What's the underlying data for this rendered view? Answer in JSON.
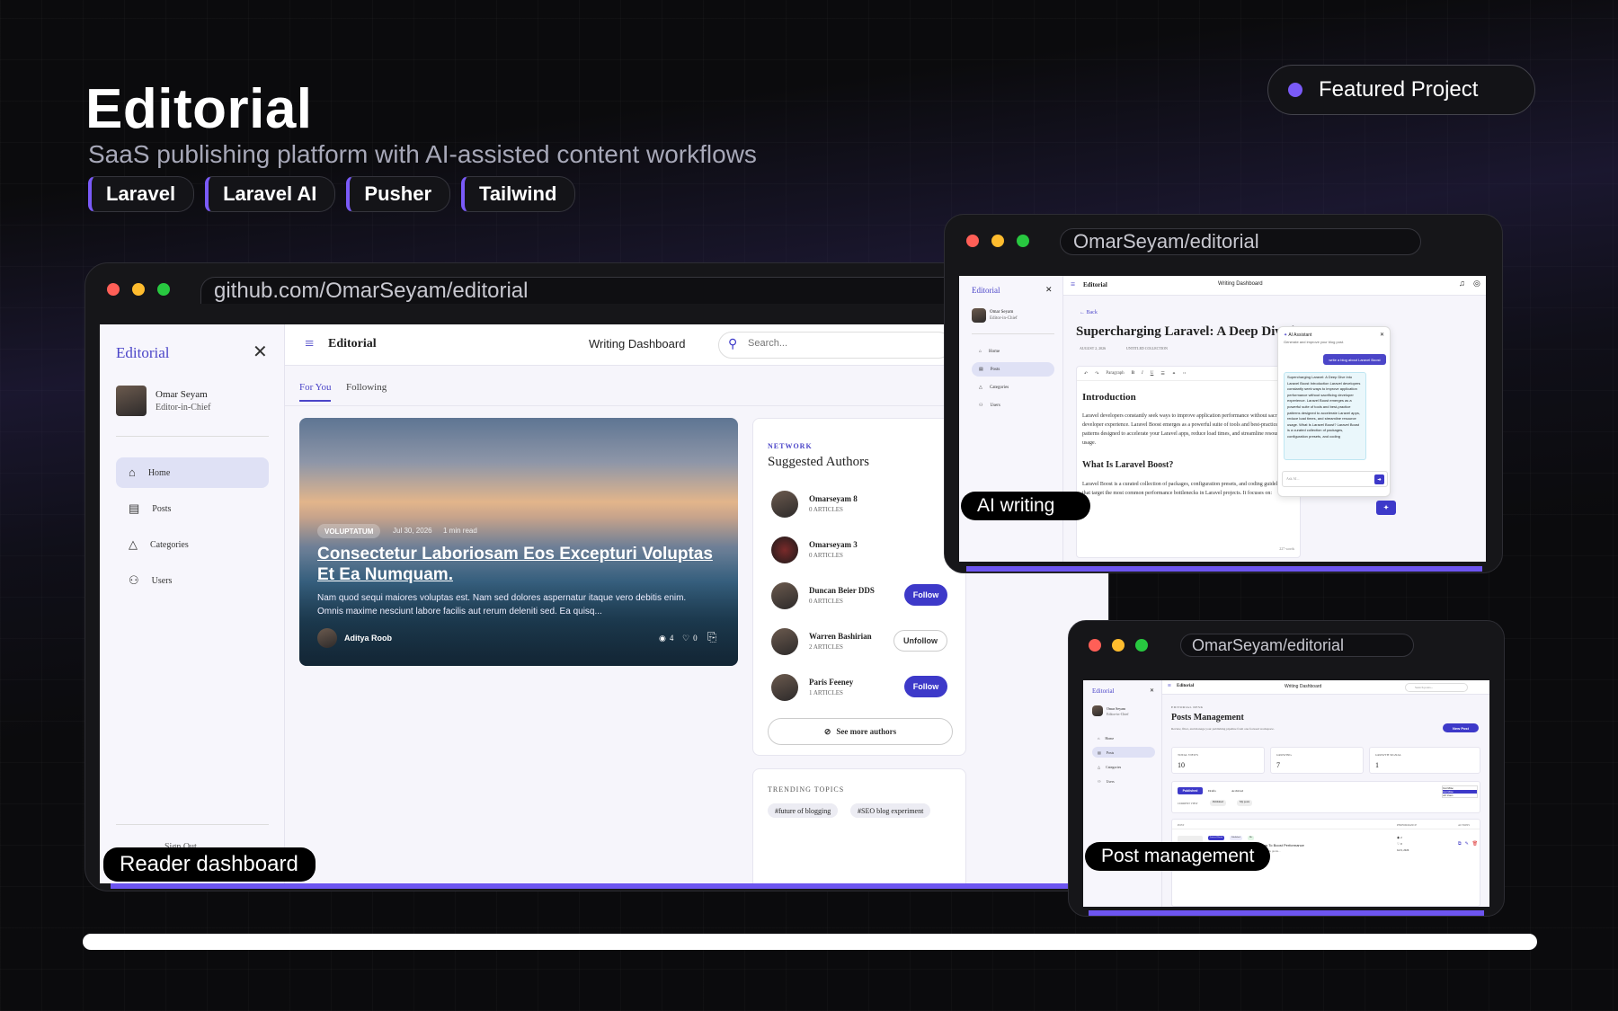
{
  "header": {
    "title": "Editorial",
    "subtitle": "SaaS publishing platform with AI-assisted content workflows",
    "tags": [
      "Laravel",
      "Laravel AI",
      "Pusher",
      "Tailwind"
    ],
    "featured": "Featured Project"
  },
  "colors": {
    "accent": "#7a5af8",
    "brand": "#4b45c8",
    "button": "#3d39c9"
  },
  "main": {
    "url": "github.com/OmarSeyam/editorial",
    "caption": "Reader dashboard",
    "sidebar": {
      "brand": "Editorial",
      "user_name": "Omar Seyam",
      "user_role": "Editor-in-Chief",
      "items": [
        "Home",
        "Posts",
        "Categories",
        "Users"
      ],
      "footer": "Sign Out"
    },
    "topbar": {
      "brand": "Editorial",
      "page": "Writing Dashboard",
      "search_placeholder": "Search..."
    },
    "tabs": [
      "For You",
      "Following"
    ],
    "hero": {
      "badge": "VOLUPTATUM",
      "date": "Jul 30, 2026",
      "read": "1 min read",
      "title": "Consectetur Laboriosam Eos Excepturi Voluptas Et Ea Numquam.",
      "excerpt": "Nam quod sequi maiores voluptas est. Nam sed dolores aspernatur itaque vero debitis enim. Omnis maxime nesciunt labore facilis aut rerum deleniti sed. Ea quisq...",
      "author": "Aditya Roob",
      "views": "4",
      "likes": "0"
    },
    "authors": {
      "eyebrow": "NETWORK",
      "title": "Suggested Authors",
      "list": [
        {
          "name": "Omarseyam 8",
          "articles": "0 ARTICLES",
          "action": ""
        },
        {
          "name": "Omarseyam 3",
          "articles": "0 ARTICLES",
          "action": ""
        },
        {
          "name": "Duncan Beier DDS",
          "articles": "0 ARTICLES",
          "action": "Follow"
        },
        {
          "name": "Warren Bashirian",
          "articles": "2 ARTICLES",
          "action": "Unfollow"
        },
        {
          "name": "Paris Feeney",
          "articles": "1 ARTICLES",
          "action": "Follow"
        }
      ],
      "more": "See more authors"
    },
    "trending": {
      "title": "TRENDING TOPICS",
      "topics": [
        "#future of blogging",
        "#SEO blog experiment"
      ]
    }
  },
  "ai": {
    "url": "OmarSeyam/editorial",
    "caption": "AI writing",
    "sidebar": {
      "brand": "Editorial",
      "user_name": "Omar Seyam",
      "user_role": "Editor-in-Chief",
      "items": [
        "Home",
        "Posts",
        "Categories",
        "Users"
      ]
    },
    "topbar": {
      "brand": "Editorial",
      "page": "Writing Dashboard"
    },
    "back": "Back",
    "post_title": "Supercharging Laravel: A Deep Dive into Laravel Boost",
    "meta_date": "AUGUST 2, 2026",
    "meta_collection": "UNTITLED COLLECTION",
    "format": "Paragraph",
    "h_intro": "Introduction",
    "p_intro": "Laravel developers constantly seek ways to improve application performance without sacrificing developer experience. Laravel Boost emerges as a powerful suite of tools and best-practice patterns designed to accelerate your Laravel apps, reduce load times, and streamline resource usage.",
    "h_what": "What Is Laravel Boost?",
    "p_what": "Laravel Boost is a curated collection of packages, configuration presets, and coding guidelines that target the most common performance bottlenecks in Laravel projects. It focuses on:",
    "words": "227 words",
    "assistant": {
      "title": "AI Assistant",
      "subtitle": "Generate and improve your blog post.",
      "user_msg": "write a blog about Laravel Boost",
      "reply": "Supercharging Laravel: A Deep Dive into Laravel Boost Introduction Laravel developers constantly seek ways to improve application performance without sacrificing developer experience. Laravel Boost emerges as a powerful suite of tools and best-practice patterns designed to accelerate Laravel apps, reduce load times, and streamline resource usage. What Is Laravel Boost? Laravel Boost is a curated collection of packages, configuration presets, and coding",
      "input": "Ask AI..."
    }
  },
  "posts": {
    "url": "OmarSeyam/editorial",
    "caption": "Post management",
    "sidebar": {
      "brand": "Editorial",
      "user_name": "Omar Seyam",
      "user_role": "Editor-in-Chief",
      "items": [
        "Home",
        "Posts",
        "Categories",
        "Users"
      ]
    },
    "topbar": {
      "brand": "Editorial",
      "page": "Writing Dashboard",
      "search_placeholder": "Search posts..."
    },
    "eyebrow": "EDITORIAL DESK",
    "title": "Posts Management",
    "desc": "Review, filter, and manage your publishing pipeline from one focused workspace.",
    "new_btn": "New Post",
    "stats": [
      {
        "label": "TOTAL VIEWS",
        "value": "10"
      },
      {
        "label": "GROWING",
        "value": "7"
      },
      {
        "label": "GROWTH SIGNAL",
        "value": "1"
      }
    ],
    "filters": [
      "Published",
      "Drafts",
      "Archived"
    ],
    "dropdown": [
      "Just Mine",
      "Just Mine",
      "All Users"
    ],
    "current_view": "CURRENT VIEW",
    "view_chips": [
      "Published",
      "My posts"
    ],
    "cols": [
      "POST",
      "PERFORMANCE",
      "ACTIONS"
    ],
    "row": {
      "chips": [
        "Laravel Boost",
        "Published",
        "Me"
      ],
      "title": "Supercharging Laravel: Practical Tips To Boost Performance",
      "snippet": "Why don't need to rewrite code to regain speed. This guide...",
      "views": "2",
      "likes": "0",
      "date": "Jul 9, 2026"
    }
  }
}
